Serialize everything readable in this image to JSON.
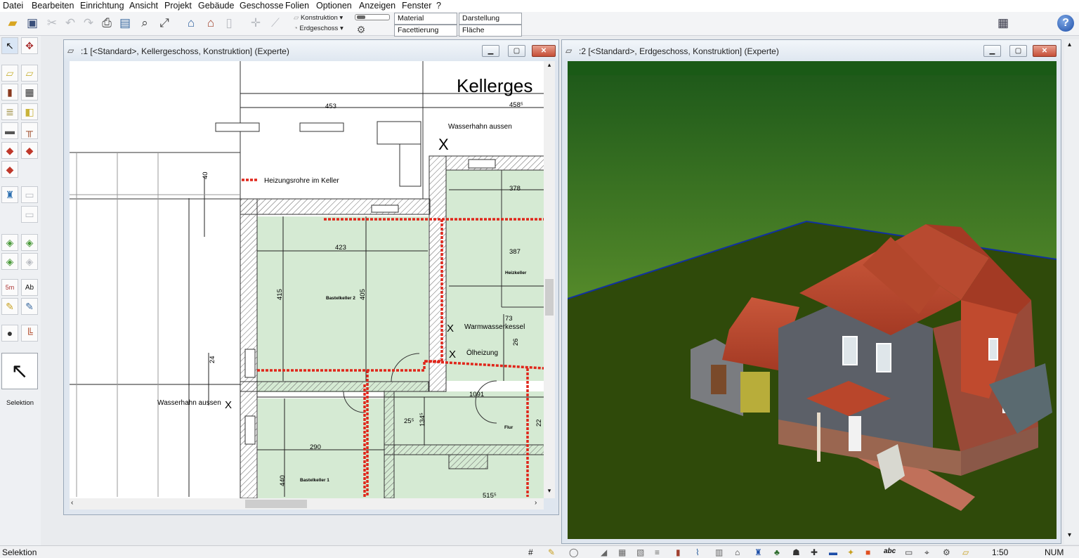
{
  "menu": [
    "Datei",
    "Bearbeiten",
    "Einrichtung",
    "Ansicht",
    "Projekt",
    "Gebäude",
    "Geschosse",
    "Folien",
    "Optionen",
    "Anzeigen",
    "Fenster",
    "?"
  ],
  "toolbar": {
    "combo_konstruktion": "Konstruktion",
    "combo_erdgeschoss": "Erdgeschoss",
    "tab_material": "Material",
    "tab_darstellung": "Darstellung",
    "tab_facettierung": "Facettierung",
    "tab_flaeche": "Fläche",
    "help": "?"
  },
  "palette": {
    "selektion_label": "Selektion"
  },
  "window1": {
    "title": ":1 [<Standard>, Kellergeschoss, Konstruktion] (Experte)",
    "plan": {
      "heading": "Kellerges",
      "rooms": [
        "Bastelkeller 2",
        "Heizkeller",
        "Flur",
        "Bastelkeller 1"
      ],
      "labels": [
        "Wasserhahn aussen",
        "Heizungsrohre im Keller",
        "Warmwasserkessel",
        "Ölheizung",
        "Wasserhahn aussen"
      ],
      "dimensions": [
        "453",
        "458⁵",
        "378",
        "423",
        "387",
        "415",
        "405",
        "73",
        "26",
        "1091",
        "290",
        "25⁵",
        "134⁵",
        "440",
        "24",
        "22",
        "40",
        "515⁵"
      ],
      "marker": "X"
    }
  },
  "window2": {
    "title": ":2 [<Standard>, Erdgeschoss, Konstruktion] (Experte)"
  },
  "status": {
    "left": "Selektion",
    "scale": "1:50",
    "num": "NUM",
    "abc": "abc"
  },
  "colors": {
    "room_fill": "#d5ead3",
    "pipe": "#e0261b",
    "ground": "#2f4a0a",
    "roof": "#b8432a"
  }
}
